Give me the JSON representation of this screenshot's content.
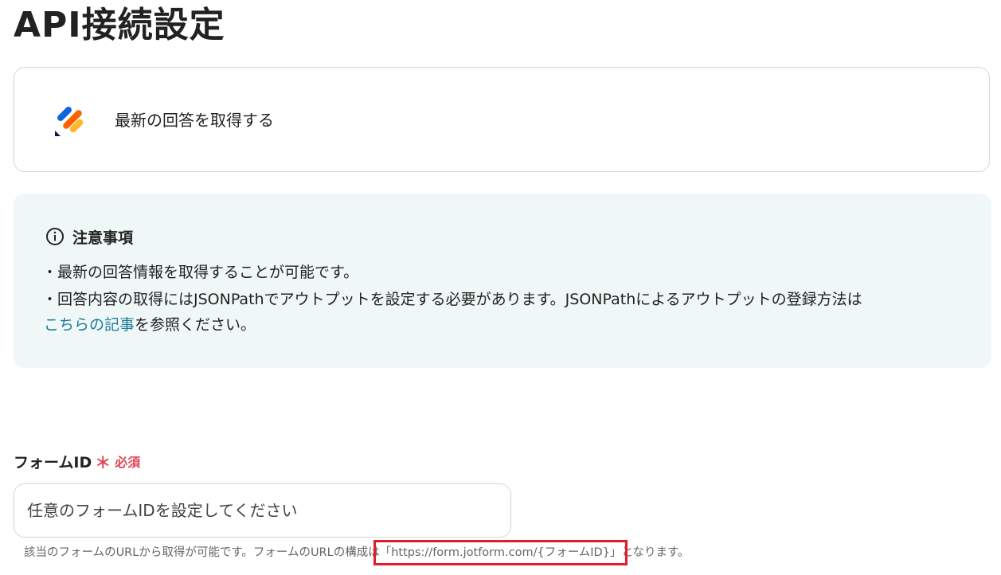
{
  "page": {
    "title": "API接続設定"
  },
  "action": {
    "label": "最新の回答を取得する",
    "logo_icon": "jotform-logo-icon",
    "logo_colors": [
      "#0a66e0",
      "#ff6100",
      "#ffb629",
      "#0a1551"
    ]
  },
  "notice": {
    "icon": "info-circle-icon",
    "title": "注意事項",
    "line1": "・最新の回答情報を取得することが可能です。",
    "line2": "・回答内容の取得にはJSONPathでアウトプットを設定する必要があります。JSONPathによるアウトプットの登録方法は",
    "link_text": "こちらの記事",
    "line3_suffix": "を参照ください。",
    "background": "#eff8f7",
    "link_color": "#1f7a9c"
  },
  "form_field": {
    "label": "フォームID",
    "required_mark": "＊",
    "required_text": "必須",
    "placeholder": "任意のフォームIDを設定してください",
    "value": "",
    "help_prefix": "該当のフォームのURLから取得が可能です。フォームのURLの構成は",
    "help_url": "「https://form.jotform.com/{フォームID}」",
    "help_suffix": "となります。",
    "required_color": "#e0485a",
    "highlight_color": "#e11d2a"
  }
}
